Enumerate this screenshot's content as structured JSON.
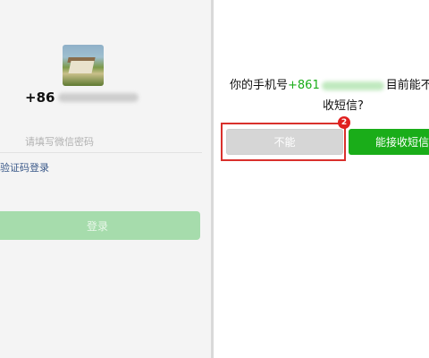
{
  "login": {
    "country_code": "+86",
    "password_placeholder": "请填写微信密码",
    "sms_login_link": "验证码登录",
    "login_button": "登录"
  },
  "dialog": {
    "question_prefix": "你的手机号",
    "phone_prefix": "+861",
    "question_suffix": "目前能不",
    "question_line2": "收短信?",
    "cannot_button": "不能",
    "can_button": "能接收短信",
    "step_badge": "2"
  },
  "colors": {
    "accent_green": "#1aad19",
    "highlight_red": "#d9302c"
  }
}
